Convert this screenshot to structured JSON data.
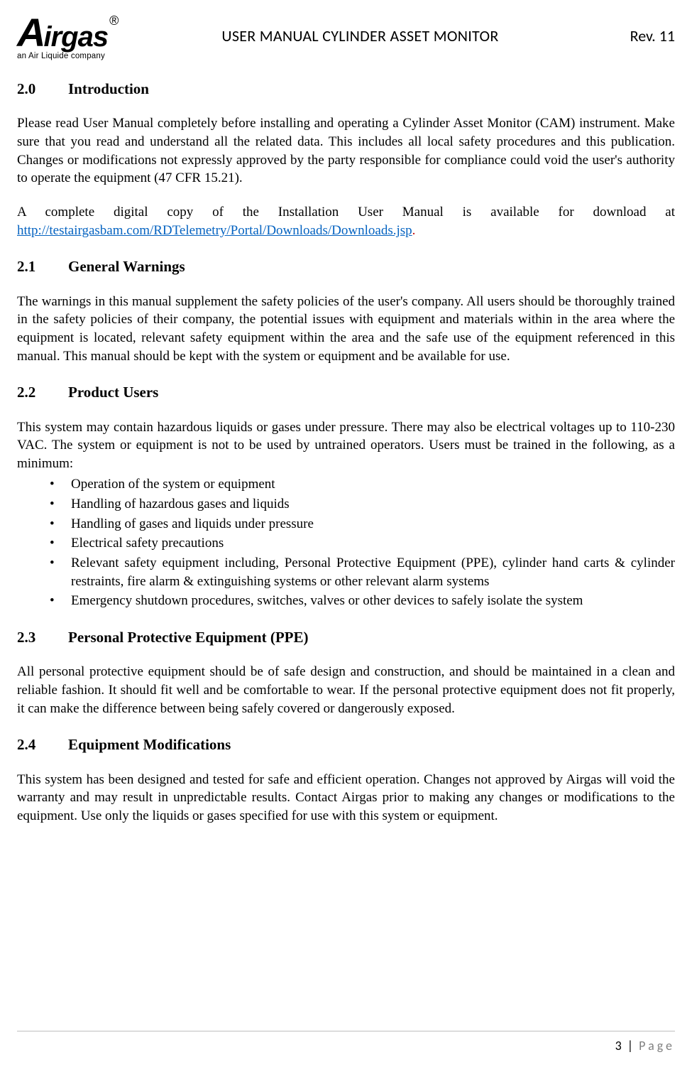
{
  "header": {
    "logo_big": "A",
    "logo_rest": "irgas",
    "logo_dot": "®",
    "logo_sub": "an Air Liquide company",
    "title": "USER MANUAL CYLINDER ASSET MONITOR",
    "rev": "Rev. 11"
  },
  "sections": {
    "s20": {
      "num": "2.0",
      "title": "Introduction"
    },
    "s21": {
      "num": "2.1",
      "title": "General Warnings"
    },
    "s22": {
      "num": "2.2",
      "title": "Product Users"
    },
    "s23": {
      "num": "2.3",
      "title": "Personal Protective Equipment (PPE)"
    },
    "s24": {
      "num": "2.4",
      "title": "Equipment Modifications"
    }
  },
  "body": {
    "intro_p1": "Please read User Manual completely before installing and operating a Cylinder Asset Monitor (CAM) instrument. Make sure that you read and understand all the related data. This includes all local safety procedures and this publication. Changes or modifications not expressly approved by the party responsible for compliance could void the user's authority to operate the equipment (47 CFR 15.21).",
    "intro_p2_pre": "A complete digital copy of the Installation User Manual is available for download at ",
    "intro_link": "http://testairgasbam.com/RDTelemetry/Portal/Downloads/Downloads.jsp",
    "intro_dot": ".",
    "warnings_p": "The warnings in this manual supplement the safety policies of the user's company. All users should be thoroughly trained in the safety policies of their company, the potential issues with equipment and materials within in the area where the equipment is located, relevant safety equipment within the area and the safe use of the equipment referenced in this manual. This manual should be kept with the system or equipment and be available for use.",
    "users_p": "This system may contain hazardous liquids or gases under pressure. There may also be electrical voltages up to 110-230 VAC. The system or equipment is not to be used by untrained operators. Users must be trained in the following, as a minimum:",
    "training": [
      "Operation of the system or equipment",
      "Handling of hazardous gases and liquids",
      "Handling of gases and liquids under pressure",
      "Electrical safety precautions",
      "Relevant safety equipment including, Personal Protective Equipment (PPE), cylinder hand carts & cylinder restraints, fire alarm & extinguishing systems or other relevant alarm systems",
      "Emergency shutdown procedures, switches, valves or other devices to safely isolate the system"
    ],
    "ppe_p": "All personal protective equipment should be of safe design and construction, and should be maintained in a clean and reliable fashion. It should fit well and be comfortable to wear. If the personal protective equipment does not fit properly, it can make the difference between being safely covered or dangerously exposed.",
    "mods_p": "This system has been designed and tested for safe and efficient operation. Changes not approved by Airgas will void the warranty and may result in unpredictable results. Contact Airgas prior to making any changes or modifications to the equipment. Use only the liquids or gases specified for use with this system or equipment."
  },
  "footer": {
    "page_num": "3",
    "sep": " | ",
    "page_word": "Page"
  }
}
